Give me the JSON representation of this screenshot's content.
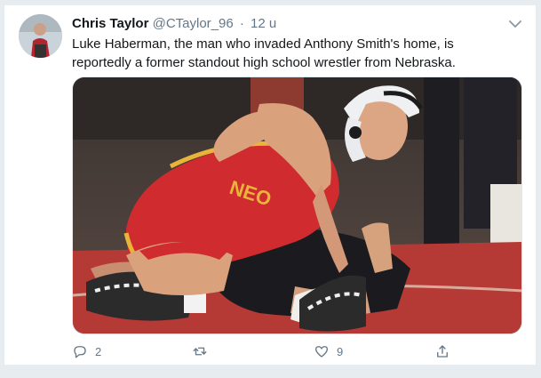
{
  "tweet": {
    "author_name": "Chris Taylor",
    "author_handle": "@CTaylor_96",
    "separator": "·",
    "time": "12 u",
    "text": "Luke Haberman, the man who invaded Anthony Smith's home, is reportedly a former standout high school wrestler from Nebraska.",
    "media_jersey_text": "NEO",
    "actions": {
      "reply_count": "2",
      "retweet_count": "",
      "like_count": "9"
    }
  },
  "colors": {
    "icon_gray": "#657786",
    "text": "#14171a",
    "singlet_red": "#d02b2e",
    "mat_red": "#b53a35",
    "jersey_gold": "#e8b53a"
  },
  "icons": {
    "reply": "reply-icon",
    "retweet": "retweet-icon",
    "like": "heart-icon",
    "share": "share-icon",
    "menu": "chevron-down-icon"
  }
}
